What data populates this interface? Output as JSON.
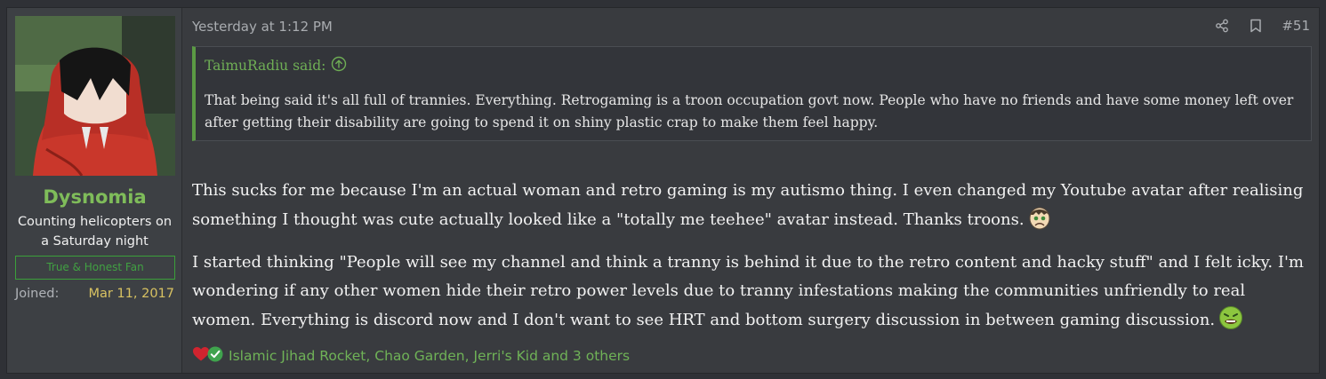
{
  "user": {
    "name": "Dysnomia",
    "title": "Counting helicopters on a Saturday night",
    "banner": "True & Honest Fan",
    "joined_label": "Joined:",
    "joined_date": "Mar 11, 2017"
  },
  "post": {
    "timestamp": "Yesterday at 1:12 PM",
    "number": "#51",
    "icons": [
      "share-icon",
      "bookmark-icon"
    ],
    "quote": {
      "author_said": "TaimuRadiu said:",
      "icon": "jump-up-arrow-icon",
      "text": "That being said it's all full of trannies. Everything. Retrogaming is a troon occupation govt now. People who have no friends and have some money left over after getting their disability are going to spend it on shiny plastic crap to make them feel happy."
    },
    "paragraph1": "This sucks for me because I'm an actual woman and retro gaming is my autismo thing. I even changed my Youtube avatar after realising something I thought was cute actually looked like a \"totally me teehee\" avatar instead. Thanks troons.",
    "paragraph1_emoji": "frowning-face-emoji",
    "paragraph2": "I started thinking \"People will see my channel and think a tranny is behind it due to the retro content and hacky stuff\" and I felt icky. I'm wondering if any other women hide their retro power levels due to tranny infestations making the communities unfriendly to real women. Everything is discord now and I don't want to see HRT and bottom surgery discussion in between gaming discussion.",
    "paragraph2_emoji": "nauseated-face-emoji",
    "reactions": {
      "icons": [
        "heart-reaction-icon",
        "check-reaction-icon"
      ],
      "list": "Islamic Jihad Rocket, Chao Garden, Jerri's Kid and 3 others"
    }
  },
  "colors": {
    "page_bg": "#2f3136",
    "panel_bg": "#393b3f",
    "username": "#7fbc5a",
    "quote_accent": "#5b9a44",
    "joined_date": "#d8c262",
    "reaction_text": "#6fb257"
  }
}
